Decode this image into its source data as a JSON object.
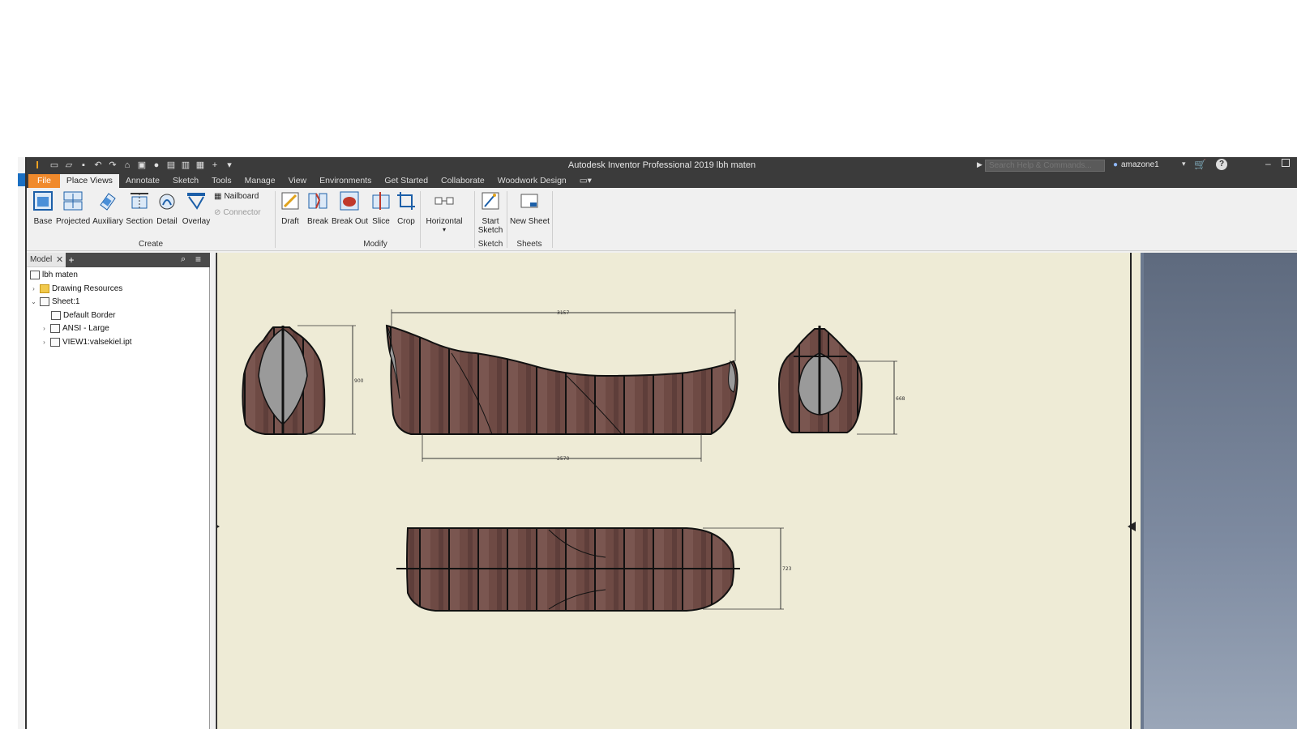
{
  "window": {
    "title": "Autodesk Inventor Professional 2019    lbh maten",
    "search_placeholder": "Search Help & Commands...",
    "user": "amazone1"
  },
  "tabs": [
    {
      "label": "File"
    },
    {
      "label": "Place Views"
    },
    {
      "label": "Annotate"
    },
    {
      "label": "Sketch"
    },
    {
      "label": "Tools"
    },
    {
      "label": "Manage"
    },
    {
      "label": "View"
    },
    {
      "label": "Environments"
    },
    {
      "label": "Get Started"
    },
    {
      "label": "Collaborate"
    },
    {
      "label": "Woodwork Design"
    }
  ],
  "ribbon": {
    "base": "Base",
    "projected": "Projected",
    "auxiliary": "Auxiliary",
    "section": "Section",
    "detail": "Detail",
    "overlay": "Overlay",
    "nailboard": "Nailboard",
    "connector": "Connector",
    "draft": "Draft",
    "break": "Break",
    "break_out": "Break Out",
    "slice": "Slice",
    "crop": "Crop",
    "horizontal": "Horizontal",
    "start_sketch_1": "Start",
    "start_sketch_2": "Sketch",
    "new_sheet": "New Sheet",
    "panels": {
      "create": "Create",
      "modify": "Modify",
      "sketch": "Sketch",
      "sheets": "Sheets"
    }
  },
  "browser": {
    "tab": "Model",
    "items": [
      {
        "label": "lbh maten"
      },
      {
        "label": "Drawing Resources"
      },
      {
        "label": "Sheet:1"
      },
      {
        "label": "Default Border"
      },
      {
        "label": "ANSI - Large"
      },
      {
        "label": "VIEW1:valsekiel.ipt"
      }
    ]
  },
  "drawing": {
    "dim_top": "3157",
    "dim_bottom": "2570",
    "dim_front_height": "900",
    "dim_rear_height": "668",
    "dim_plan_width": "723"
  },
  "colors": {
    "accent": "#f08a2c",
    "sheet": "#eeebd6",
    "hull": "#6e4a44"
  }
}
